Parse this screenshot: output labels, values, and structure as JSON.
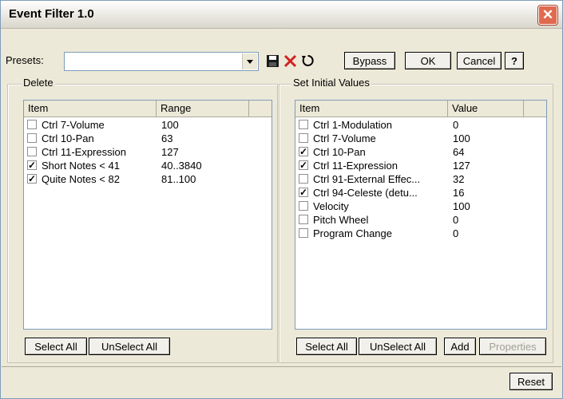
{
  "window": {
    "title": "Event Filter 1.0",
    "close": "✕"
  },
  "toolbar": {
    "presets_label": "Presets:",
    "presets_value": "",
    "bypass": "Bypass",
    "ok": "OK",
    "cancel": "Cancel",
    "help": "?"
  },
  "delete": {
    "label": "Delete",
    "headers": [
      "Item",
      "Range"
    ],
    "rows": [
      {
        "item": "Ctrl 7-Volume",
        "value": "100",
        "checked": false
      },
      {
        "item": "Ctrl 10-Pan",
        "value": "63",
        "checked": false
      },
      {
        "item": "Ctrl 11-Expression",
        "value": "127",
        "checked": false
      },
      {
        "item": "Short Notes < 41",
        "value": "40..3840",
        "checked": true
      },
      {
        "item": "Quite Notes < 82",
        "value": "81..100",
        "checked": true
      }
    ],
    "select_all": "Select All",
    "unselect_all": "UnSelect All"
  },
  "initial": {
    "label": "Set Initial Values",
    "headers": [
      "Item",
      "Value"
    ],
    "rows": [
      {
        "item": "Ctrl 1-Modulation",
        "value": "0",
        "checked": false
      },
      {
        "item": "Ctrl 7-Volume",
        "value": "100",
        "checked": false
      },
      {
        "item": "Ctrl 10-Pan",
        "value": "64",
        "checked": true
      },
      {
        "item": "Ctrl 11-Expression",
        "value": "127",
        "checked": true
      },
      {
        "item": "Ctrl 91-External Effec...",
        "value": "32",
        "checked": false
      },
      {
        "item": "Ctrl 94-Celeste (detu...",
        "value": "16",
        "checked": true
      },
      {
        "item": "Velocity",
        "value": "100",
        "checked": false
      },
      {
        "item": "Pitch Wheel",
        "value": "0",
        "checked": false
      },
      {
        "item": "Program Change",
        "value": "0",
        "checked": false
      }
    ],
    "select_all": "Select All",
    "unselect_all": "UnSelect All",
    "add": "Add",
    "properties": "Properties"
  },
  "footer": {
    "reset": "Reset"
  },
  "icons": {
    "save": "save-icon",
    "delete": "delete-icon",
    "refresh": "refresh-icon"
  },
  "colors": {
    "delete_x": "#d42020",
    "close_bg": "#e06a4f"
  }
}
